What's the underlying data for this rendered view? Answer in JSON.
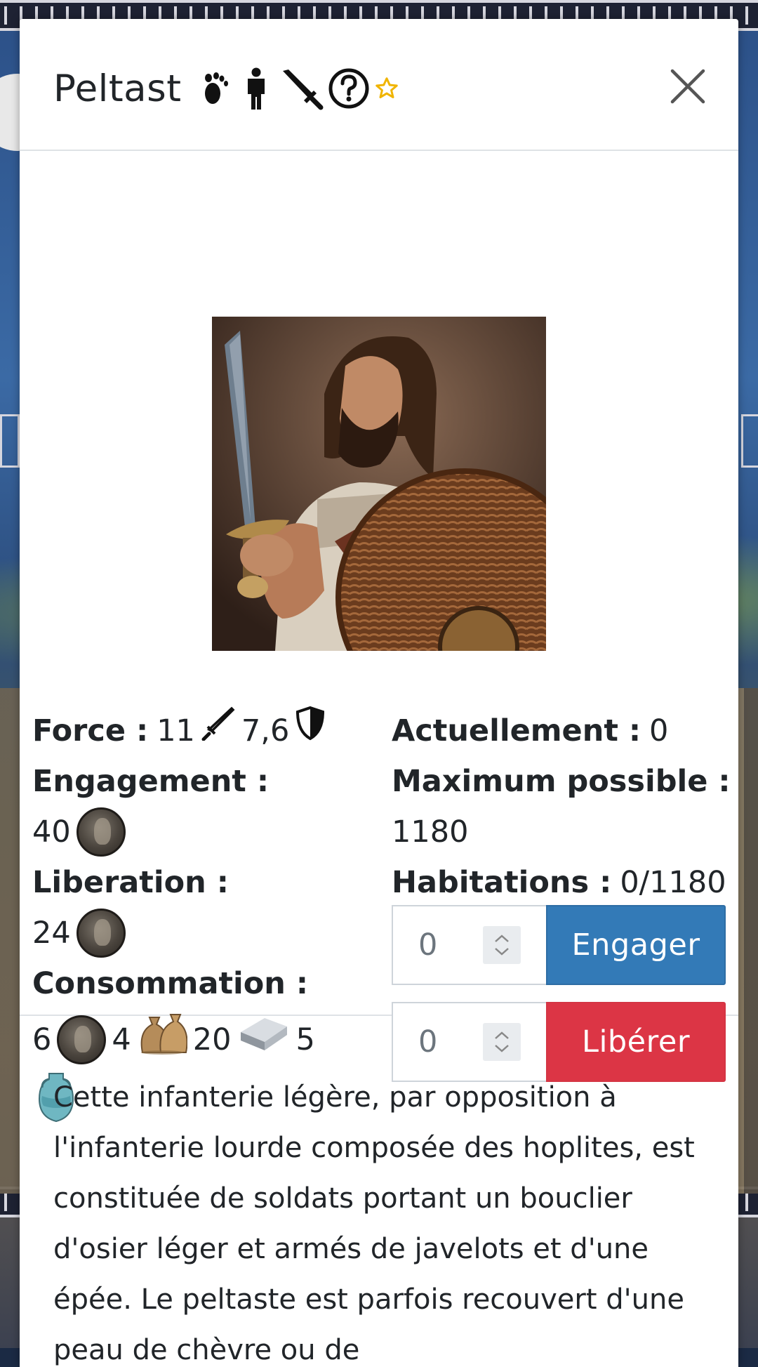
{
  "modal": {
    "title": "Peltast",
    "header_icons": [
      "footprint-icon",
      "person-icon",
      "sword-icon",
      "question-circle-icon",
      "star-icon"
    ],
    "close_icon": "close-icon"
  },
  "stats": {
    "force_label": "Force :",
    "force_attack": "11",
    "force_defense": "7,6",
    "engagement_label": "Engagement :",
    "engagement_cost": "40",
    "liberation_label": "Liberation :",
    "liberation_cost": "24",
    "consumption_label": "Consommation :",
    "consumption": [
      {
        "amount": "6",
        "resource": "coin"
      },
      {
        "amount": "4",
        "resource": "grain-sacks"
      },
      {
        "amount": "20",
        "resource": "silver-ingot"
      },
      {
        "amount": "5",
        "resource": "amphora"
      }
    ]
  },
  "status": {
    "current_label": "Actuellement :",
    "current_value": "0",
    "max_label": "Maximum possible :",
    "max_value": "1180",
    "housing_label": "Habitations :",
    "housing_value": "0/1180"
  },
  "actions": {
    "engage_input_value": "0",
    "engage_label": "Engager",
    "release_input_value": "0",
    "release_label": "Libérer"
  },
  "description": "Cette infanterie légère, par opposition à l'infanterie lourde composée des hoplites, est constituée de soldats portant un bouclier d'osier léger et armés de javelots et d'une épée. Le peltaste est parfois recouvert d'une peau de chèvre ou de",
  "colors": {
    "engage": "#337ab7",
    "release": "#dc3545",
    "star": "#f0b400"
  }
}
